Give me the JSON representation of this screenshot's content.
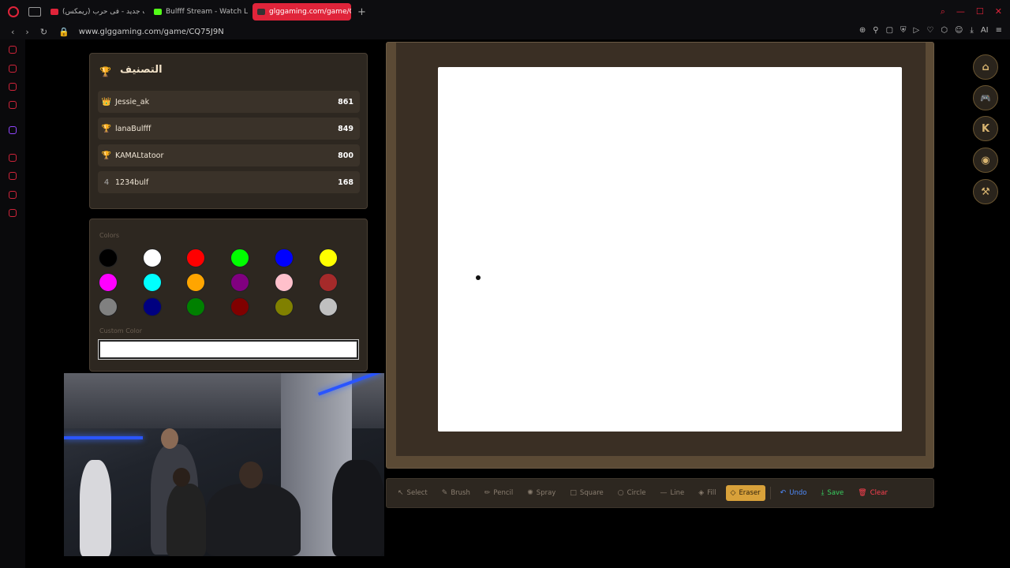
{
  "browser": {
    "tabs": [
      {
        "label": "شب جدید - فی حرب (ریمکس)",
        "favicon_color": "#e0243a"
      },
      {
        "label": "Bulfff Stream - Watch Live",
        "favicon_color": "#53fc18"
      },
      {
        "label": "glggaming.com/game/CQ",
        "favicon_color": "#333333"
      }
    ],
    "url": "www.glggaming.com/game/CQ75J9N",
    "ai_label": "AI"
  },
  "leaderboard": {
    "title": "التصنيف",
    "entries": [
      {
        "rank": "👑",
        "name": "Jessie_ak",
        "score": "861"
      },
      {
        "rank": "🏆",
        "name": "lanaBulfff",
        "score": "849"
      },
      {
        "rank": "🏆",
        "name": "KAMALtatoor",
        "score": "800"
      },
      {
        "rank": "4",
        "name": "1234bulf",
        "score": "168"
      }
    ]
  },
  "colors": {
    "label": "Colors",
    "swatches": [
      "#000000",
      "#ffffff",
      "#ff0000",
      "#00ff00",
      "#0000ff",
      "#ffff00",
      "#ff00ff",
      "#00ffff",
      "#ffa500",
      "#800080",
      "#ffc0cb",
      "#a52a2a",
      "#808080",
      "#000080",
      "#008000",
      "#800000",
      "#808000",
      "#c0c0c0"
    ],
    "custom_label": "Custom Color",
    "custom_value": ""
  },
  "right_nav": [
    {
      "icon": "home-icon",
      "glyph": "⌂"
    },
    {
      "icon": "gamepad-icon",
      "glyph": "🎮"
    },
    {
      "icon": "kick-icon",
      "glyph": "K"
    },
    {
      "icon": "discord-icon",
      "glyph": "◉"
    },
    {
      "icon": "brush-icon",
      "glyph": "⚒"
    }
  ],
  "toolbar": {
    "tools": [
      {
        "label": "Select",
        "glyph": "↖"
      },
      {
        "label": "Brush",
        "glyph": "✎"
      },
      {
        "label": "Pencil",
        "glyph": "✏"
      },
      {
        "label": "Spray",
        "glyph": "✺"
      },
      {
        "label": "Square",
        "glyph": "□"
      },
      {
        "label": "Circle",
        "glyph": "○"
      },
      {
        "label": "Line",
        "glyph": "—"
      },
      {
        "label": "Fill",
        "glyph": "◈"
      },
      {
        "label": "Eraser",
        "glyph": "◇"
      }
    ],
    "active_tool": "Eraser",
    "undo_label": "Undo",
    "save_label": "Save",
    "clear_label": "Clear"
  }
}
